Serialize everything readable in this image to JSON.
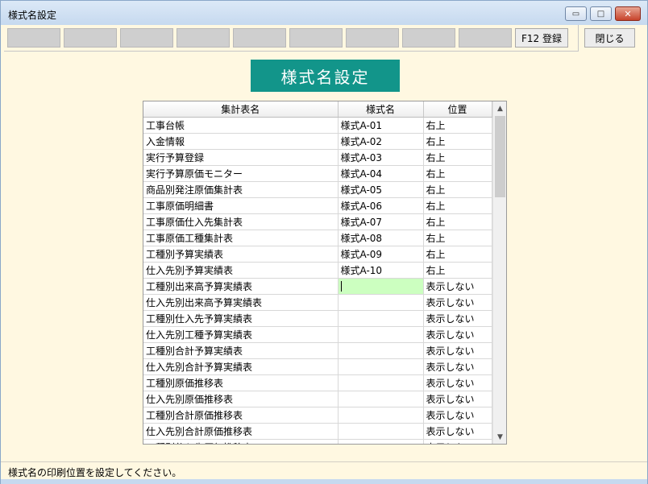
{
  "window": {
    "title": "様式名設定",
    "min_glyph": "▭",
    "max_glyph": "□",
    "close_glyph": "✕"
  },
  "toolbar": {
    "function_keys": [
      "",
      "",
      "",
      "",
      "",
      "",
      "",
      "",
      ""
    ],
    "register_label": "F12 登録",
    "close_label": "閉じる"
  },
  "banner": {
    "title": "様式名設定"
  },
  "grid": {
    "columns": [
      "集計表名",
      "様式名",
      "位置"
    ],
    "rows": [
      [
        "工事台帳",
        "様式A-01",
        "右上"
      ],
      [
        "入金情報",
        "様式A-02",
        "右上"
      ],
      [
        "実行予算登録",
        "様式A-03",
        "右上"
      ],
      [
        "実行予算原価モニター",
        "様式A-04",
        "右上"
      ],
      [
        "商品別発注原価集計表",
        "様式A-05",
        "右上"
      ],
      [
        "工事原価明細書",
        "様式A-06",
        "右上"
      ],
      [
        "工事原価仕入先集計表",
        "様式A-07",
        "右上"
      ],
      [
        "工事原価工種集計表",
        "様式A-08",
        "右上"
      ],
      [
        "工種別予算実績表",
        "様式A-09",
        "右上"
      ],
      [
        "仕入先別予算実績表",
        "様式A-10",
        "右上"
      ],
      [
        "工種別出来高予算実績表",
        "",
        "表示しない"
      ],
      [
        "仕入先別出来高予算実績表",
        "",
        "表示しない"
      ],
      [
        "工種別仕入先予算実績表",
        "",
        "表示しない"
      ],
      [
        "仕入先別工種予算実績表",
        "",
        "表示しない"
      ],
      [
        "工種別合計予算実績表",
        "",
        "表示しない"
      ],
      [
        "仕入先別合計予算実績表",
        "",
        "表示しない"
      ],
      [
        "工種別原価推移表",
        "",
        "表示しない"
      ],
      [
        "仕入先別原価推移表",
        "",
        "表示しない"
      ],
      [
        "工種別合計原価推移表",
        "",
        "表示しない"
      ],
      [
        "仕入先別合計原価推移表",
        "",
        "表示しない"
      ],
      [
        "工種別仕入先原価推移表",
        "",
        "表示しない"
      ]
    ],
    "editing_row": 10,
    "scroll_up": "▲",
    "scroll_down": "▼"
  },
  "status": {
    "message": "様式名の印刷位置を設定してください。"
  }
}
